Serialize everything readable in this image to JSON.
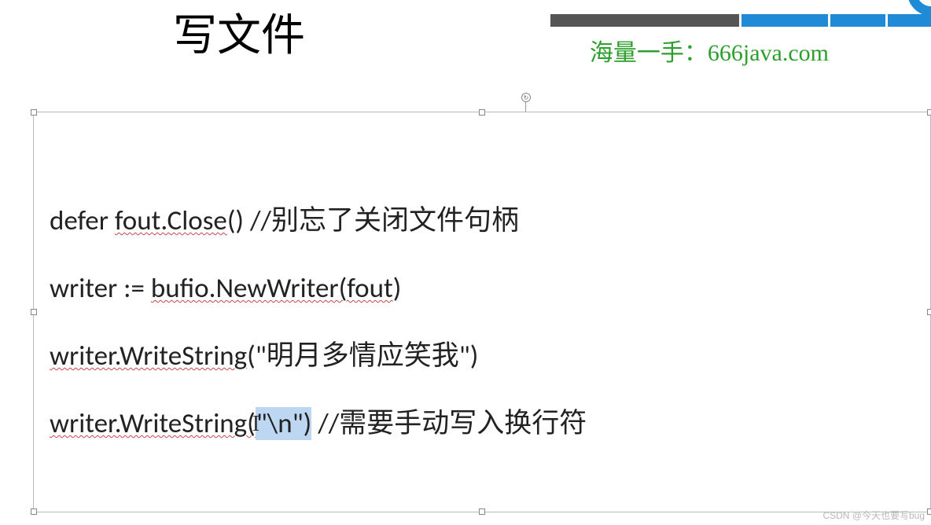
{
  "header": {
    "title": "写文件",
    "link_text": "海量一手：666java.com"
  },
  "code": {
    "line1_prefix": "defer ",
    "line1_underlined": "fout.Close",
    "line1_suffix": "() //别忘了关闭文件句柄",
    "line2_prefix": "writer := ",
    "line2_underlined": "bufio.NewWriter(fout",
    "line2_suffix": ")",
    "line3_underlined": "writer.WriteString",
    "line3_suffix": "(\"明月多情应笑我\")",
    "line4_underlined": "writer.WriteString(",
    "line4_selected": "\"\\n\")",
    "line4_suffix": " //需要手动写入换行符"
  },
  "watermark": "CSDN @今天也要写bug"
}
